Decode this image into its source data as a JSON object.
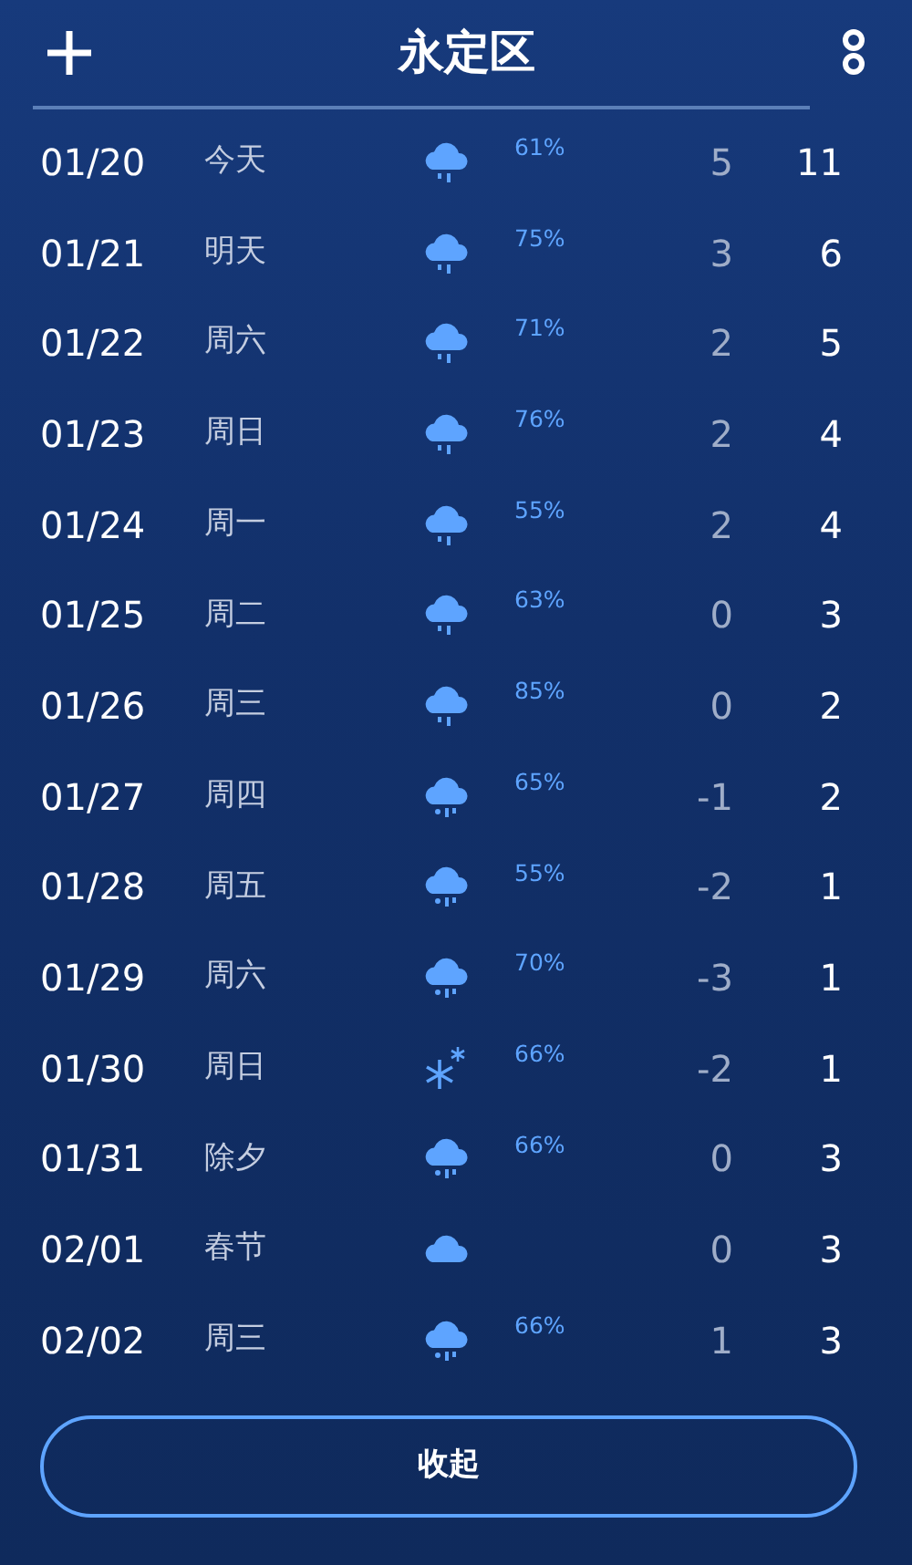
{
  "header": {
    "title": "永定区"
  },
  "days": [
    {
      "date": "01/20",
      "day": "今天",
      "kind": "rain",
      "chance": "61%",
      "low": "5",
      "high": "11"
    },
    {
      "date": "01/21",
      "day": "明天",
      "kind": "rain",
      "chance": "75%",
      "low": "3",
      "high": "6"
    },
    {
      "date": "01/22",
      "day": "周六",
      "kind": "rain",
      "chance": "71%",
      "low": "2",
      "high": "5"
    },
    {
      "date": "01/23",
      "day": "周日",
      "kind": "rain",
      "chance": "76%",
      "low": "2",
      "high": "4"
    },
    {
      "date": "01/24",
      "day": "周一",
      "kind": "rain",
      "chance": "55%",
      "low": "2",
      "high": "4"
    },
    {
      "date": "01/25",
      "day": "周二",
      "kind": "rain",
      "chance": "63%",
      "low": "0",
      "high": "3"
    },
    {
      "date": "01/26",
      "day": "周三",
      "kind": "rain",
      "chance": "85%",
      "low": "0",
      "high": "2"
    },
    {
      "date": "01/27",
      "day": "周四",
      "kind": "sleet",
      "chance": "65%",
      "low": "-1",
      "high": "2"
    },
    {
      "date": "01/28",
      "day": "周五",
      "kind": "sleet",
      "chance": "55%",
      "low": "-2",
      "high": "1"
    },
    {
      "date": "01/29",
      "day": "周六",
      "kind": "sleet",
      "chance": "70%",
      "low": "-3",
      "high": "1"
    },
    {
      "date": "01/30",
      "day": "周日",
      "kind": "snow",
      "chance": "66%",
      "low": "-2",
      "high": "1"
    },
    {
      "date": "01/31",
      "day": "除夕",
      "kind": "sleet",
      "chance": "66%",
      "low": "0",
      "high": "3"
    },
    {
      "date": "02/01",
      "day": "春节",
      "kind": "cloudy",
      "low": "0",
      "high": "3"
    },
    {
      "date": "02/02",
      "day": "周三",
      "kind": "sleet",
      "chance": "66%",
      "low": "1",
      "high": "3"
    }
  ],
  "collapse_button": "收起"
}
